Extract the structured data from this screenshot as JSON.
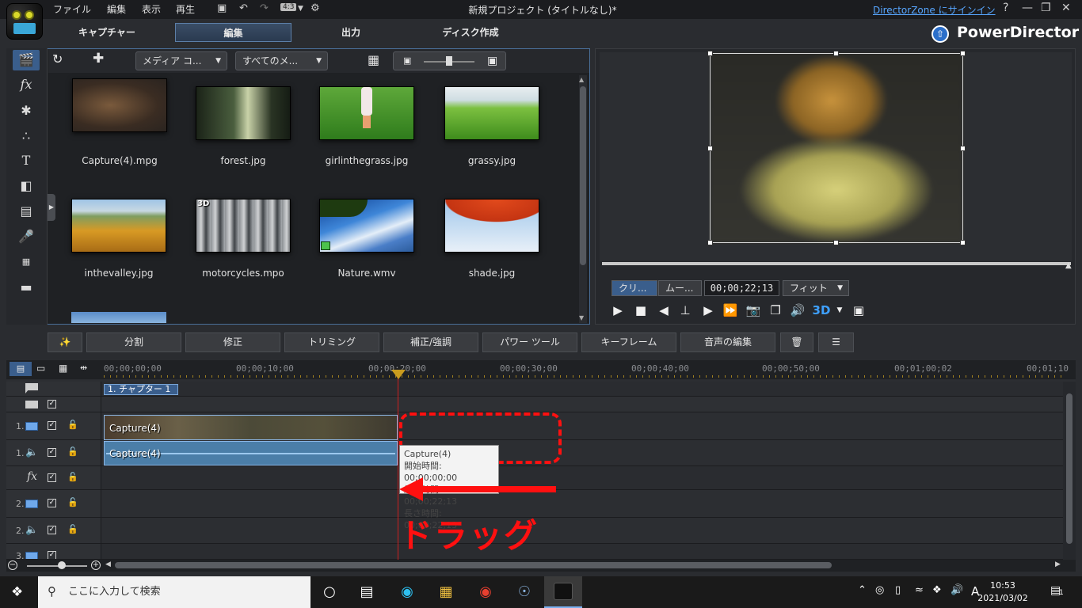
{
  "titlebar": {
    "menus": [
      "ファイル",
      "編集",
      "表示",
      "再生"
    ],
    "aspect": "4:3",
    "title": "新規プロジェクト (タイトルなし)*",
    "signin_link": "DirectorZone にサインイン",
    "help": "?"
  },
  "modes": {
    "capture": "キャプチャー",
    "edit": "編集",
    "output": "出力",
    "disc": "ディスク作成"
  },
  "brand": "PowerDirector",
  "library": {
    "filter_dropdown": "メディア コ...",
    "type_dropdown": "すべてのメ...",
    "items": [
      {
        "label": "Capture(4).mpg"
      },
      {
        "label": "forest.jpg"
      },
      {
        "label": "girlinthegrass.jpg"
      },
      {
        "label": "grassy.jpg"
      },
      {
        "label": "inthevalley.jpg"
      },
      {
        "label": "motorcycles.mpo",
        "badge": "3D"
      },
      {
        "label": "Nature.wmv"
      },
      {
        "label": "shade.jpg"
      }
    ]
  },
  "preview": {
    "clip_toggle": "クリ...",
    "movie_toggle": "ムー...",
    "timecode": "00;00;22;13",
    "fit": "フィット",
    "badge_3d": "3D"
  },
  "actions": {
    "split": "分割",
    "fix": "修正",
    "trim": "トリミング",
    "enhance": "補正/強調",
    "power_tools": "パワー ツール",
    "keyframe": "キーフレーム",
    "audio_edit": "音声の編集"
  },
  "timeline": {
    "ruler": [
      "00;00;00;00",
      "00;00;10;00",
      "00;00;20;00",
      "00;00;30;00",
      "00;00;40;00",
      "00;00;50;00",
      "00;01;00;02",
      "00;01;10"
    ],
    "chapter": "1. チャプター 1",
    "tracks": [
      {
        "num": "1.",
        "kind": "video"
      },
      {
        "num": "1.",
        "kind": "audio"
      },
      {
        "num": "",
        "kind": "fx",
        "label": "fx"
      },
      {
        "num": "2.",
        "kind": "video"
      },
      {
        "num": "2.",
        "kind": "audio"
      },
      {
        "num": "3.",
        "kind": "video"
      }
    ],
    "video_clip": "Capture(4)",
    "audio_clip": "Capture(4)",
    "tooltip": {
      "name": "Capture(4)",
      "start": "開始時間: 00;00;00;00",
      "end": "終了時間: 00;00;22;13",
      "duration": "長さ時間: 00;00;22;13"
    }
  },
  "annotation": {
    "drag_text": "ドラッグ",
    "color": "#ff1010"
  },
  "taskbar": {
    "search_placeholder": "ここに入力して検索",
    "time": "10:53",
    "date": "2021/03/02",
    "ime": "A",
    "notifications": "1"
  }
}
